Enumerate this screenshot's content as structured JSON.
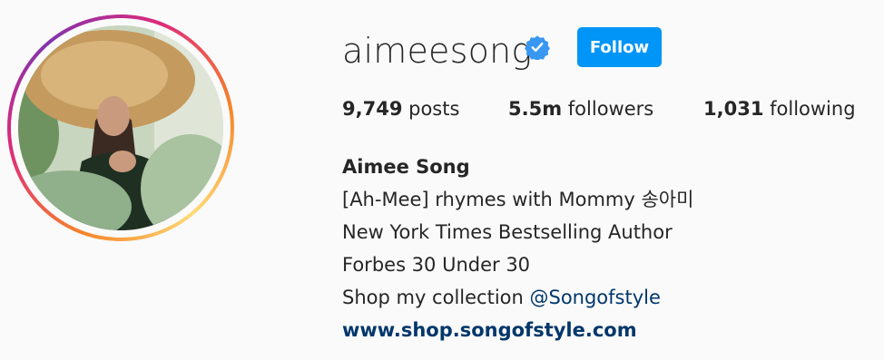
{
  "profile": {
    "username": "aimeesong",
    "verified_icon": "verified-badge-icon",
    "follow_label": "Follow",
    "accent_color": "#0095f6"
  },
  "stats": {
    "posts_count": "9,749",
    "posts_label": "posts",
    "followers_count": "5.5m",
    "followers_label": "followers",
    "following_count": "1,031",
    "following_label": "following"
  },
  "bio": {
    "full_name": "Aimee Song",
    "line1": "[Ah-Mee] rhymes with Mommy 송아미",
    "line2": "New York Times Bestselling Author",
    "line3": "Forbes 30 Under 30",
    "line4_prefix": "Shop my collection ",
    "line4_mention": "@Songofstyle",
    "website": "www.shop.songofstyle.com"
  }
}
